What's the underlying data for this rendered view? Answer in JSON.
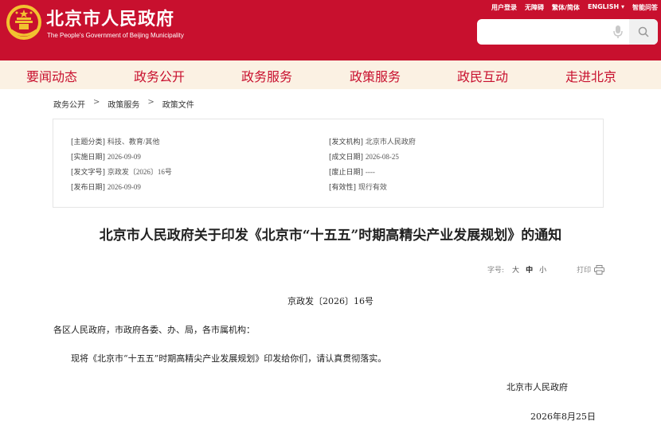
{
  "header": {
    "title": "北京市人民政府",
    "subtitle": "The People's Government of Beijing Municipality",
    "top_links": [
      "用户登录",
      "无障碍",
      "繁体/简体",
      "ENGLISH ▾",
      "智能问答"
    ],
    "search_placeholder": ""
  },
  "nav": {
    "items": [
      "要闻动态",
      "政务公开",
      "政务服务",
      "政策服务",
      "政民互动",
      "走进北京"
    ]
  },
  "breadcrumb": [
    "政务公开",
    "政策服务",
    "政策文件"
  ],
  "meta": {
    "topic_label": "[主题分类]",
    "topic_value": "科技、教育/其他",
    "agency_label": "[发文机构]",
    "agency_value": "北京市人民政府",
    "effective_label": "[实施日期]",
    "effective_value": "2026-09-09",
    "created_label": "[成文日期]",
    "created_value": "2026-08-25",
    "docno_label": "[发文字号]",
    "docno_value": "京政发〔2026〕16号",
    "repeal_label": "[废止日期]",
    "repeal_value": "----",
    "published_label": "[发布日期]",
    "published_value": "2026-09-09",
    "validity_label": "[有效性]",
    "validity_value": "现行有效"
  },
  "doc": {
    "title": "北京市人民政府关于印发《北京市“十五五”时期高精尖产业发展规划》的通知",
    "font_label": "字号:",
    "size_large": "大",
    "size_medium": "中",
    "size_small": "小",
    "print_label": "打印",
    "number": "京政发〔2026〕16号",
    "salutation": "各区人民政府，市政府各委、办、局，各市属机构：",
    "body": "现将《北京市“十五五”时期高精尖产业发展规划》印发给你们，请认真贯彻落实。",
    "signature": "北京市人民政府",
    "date": "2026年8月25日"
  },
  "colors": {
    "brand_red": "#c8102e",
    "nav_bg": "#fbf1e3"
  }
}
